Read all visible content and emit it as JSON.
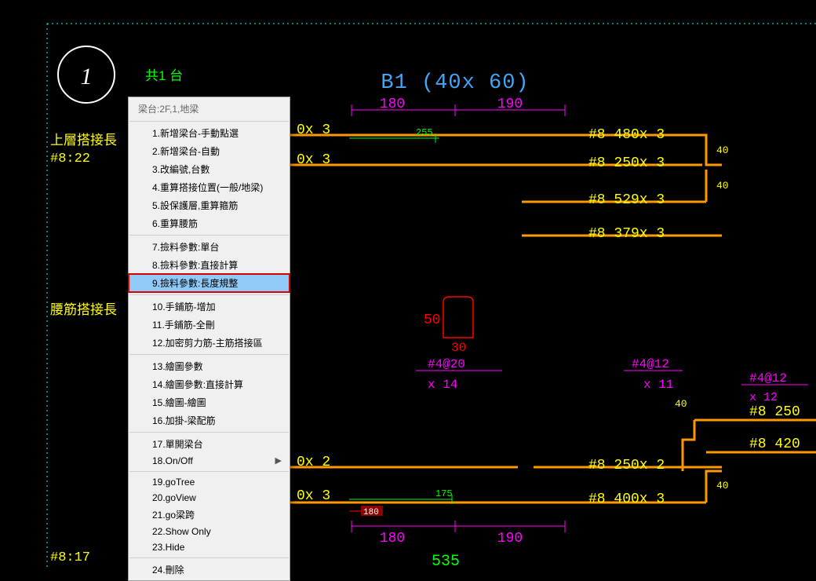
{
  "canvas": {
    "node_label": "1",
    "node_count_text": "共1 台",
    "beam_title": "B1 (40x 60)",
    "dims_top": {
      "left": "180",
      "right": "190"
    },
    "dims_bottom": {
      "left": "180",
      "right": "190"
    },
    "label_top_left_line1": "上層搭接長",
    "label_top_left_line2": "#8:22",
    "label_mid_left": "腰筋搭接長",
    "label_bottom_left": "#8:17",
    "span_green": {
      "a": "255",
      "b": "175",
      "c": "#4@20",
      "d": "x 14",
      "e": "535"
    },
    "stirrup_left": {
      "seg1": "0x 3",
      "seg2": "0x 3",
      "seg3": "0x 2",
      "seg4": "0x 3"
    },
    "right_bars": {
      "r1": "#8  480x 3",
      "r2": "#8  250x 3",
      "r3": "#8  529x 3",
      "r4": "#8  379x 3",
      "r5": "#8  250x 2",
      "r6": "#8  400x 3"
    },
    "far_right": {
      "a": "#8  250",
      "b": "#8  420"
    },
    "right_marks": {
      "m1": "40",
      "m2": "40",
      "m3": "40",
      "m4": "40"
    },
    "stirrup_center": {
      "a": "#4@12",
      "b": "x 11"
    },
    "stirrup_far": {
      "a": "#4@12",
      "b": "x 12"
    },
    "pad": {
      "h": "50",
      "w": "30"
    },
    "dim_bottom_red": "180"
  },
  "menu": {
    "title": "梁台:2F,1,地梁",
    "items": [
      {
        "label": "1.新增梁台-手動點選",
        "sep_before": true
      },
      {
        "label": "2.新增梁台-自動"
      },
      {
        "label": "3.改編號,台數"
      },
      {
        "label": "4.重算搭接位置(一般/地梁)"
      },
      {
        "label": "5.設保護層,重算箍筋"
      },
      {
        "label": "6.重算腰筋"
      },
      {
        "label": "7.撿料參數:單台",
        "sep_before": true
      },
      {
        "label": "8.撿料參數:直接計算"
      },
      {
        "label": "9.撿料參數:長度規整",
        "selected": true,
        "boxed": true
      },
      {
        "label": "10.手鋪筋-增加",
        "sep_before": true
      },
      {
        "label": "11.手鋪筋-全刪"
      },
      {
        "label": "12.加密剪力筋-主筋搭接區"
      },
      {
        "label": "13.繪圖參數",
        "sep_before": true
      },
      {
        "label": "14.繪圖參數:直接計算"
      },
      {
        "label": "15.繪圖-繪圖"
      },
      {
        "label": "16.加掛-梁配筋"
      },
      {
        "label": "17.單開梁台",
        "sep_before": true
      },
      {
        "label": "18.On/Off",
        "submenu": true
      },
      {
        "label": "19.goTree",
        "sep_before": true
      },
      {
        "label": "20.goView"
      },
      {
        "label": "21.go梁跨"
      },
      {
        "label": "22.Show Only"
      },
      {
        "label": "23.Hide"
      },
      {
        "label": "24.刪除",
        "sep_before": true
      }
    ]
  }
}
